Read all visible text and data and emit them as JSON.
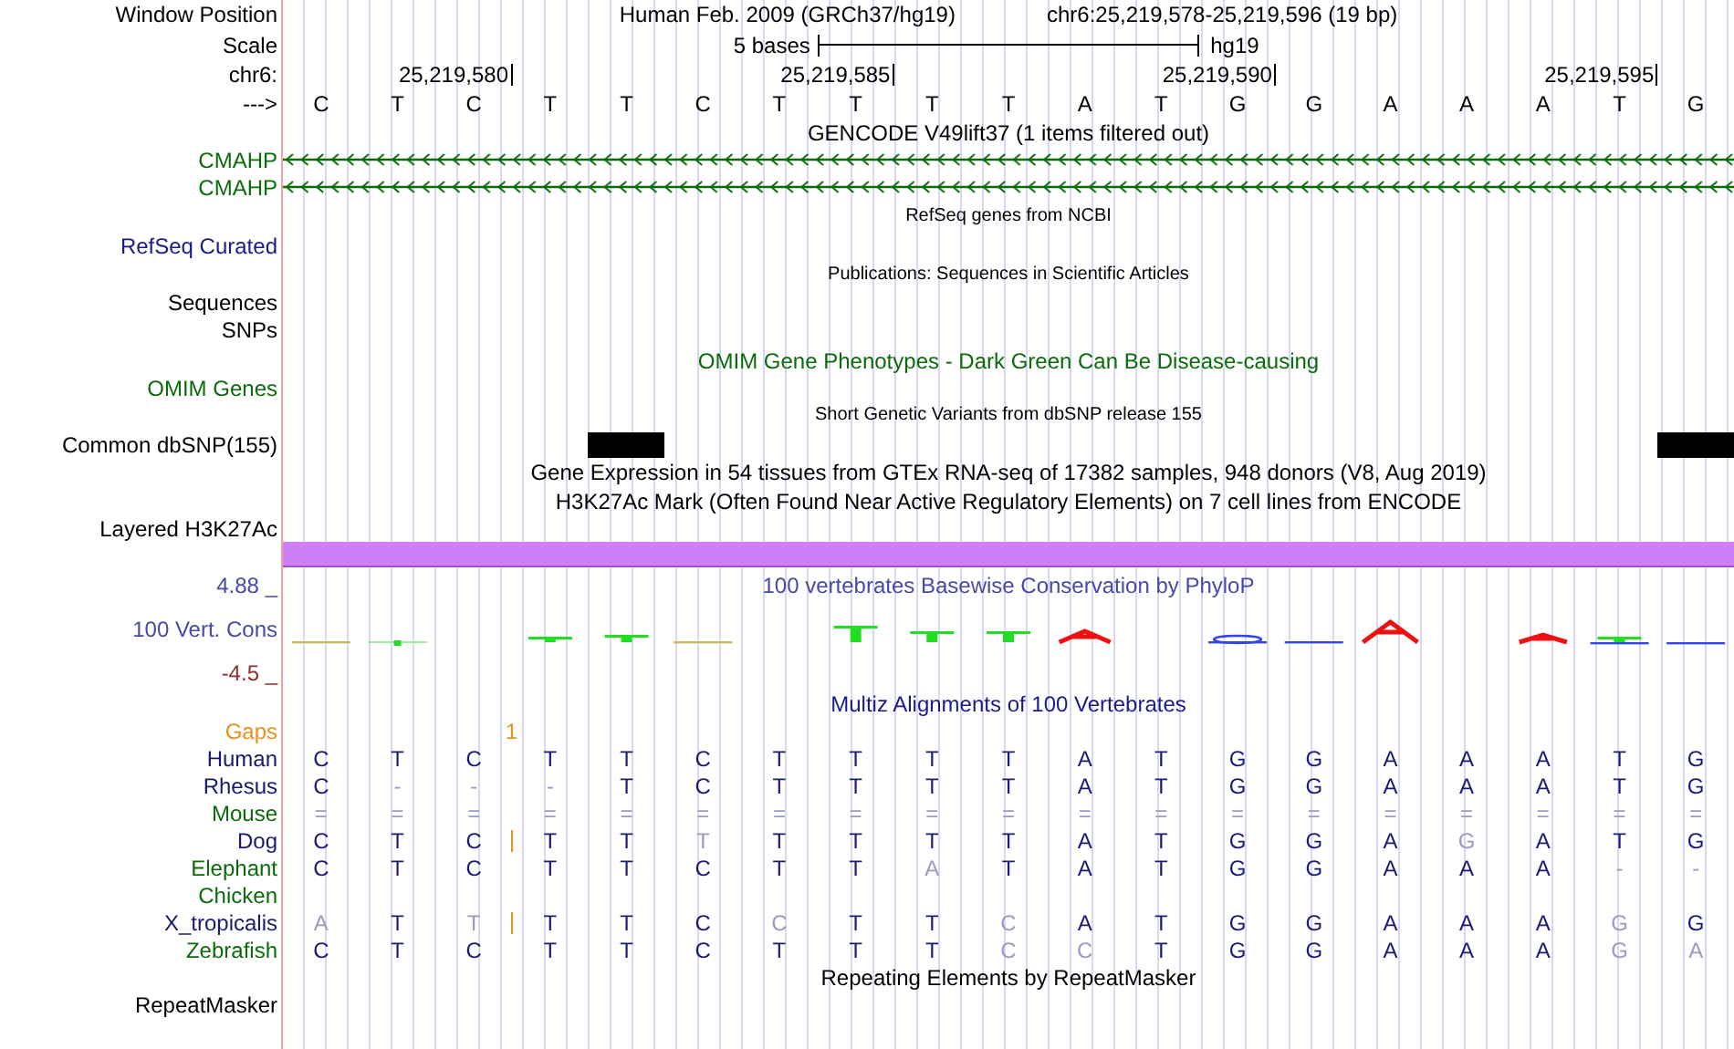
{
  "position": {
    "label": "Window Position",
    "assembly": "Human Feb. 2009 (GRCh37/hg19)",
    "range": "chr6:25,219,578-25,219,596 (19 bp)"
  },
  "scale": {
    "label": "Scale",
    "span": "5 bases",
    "db": "hg19"
  },
  "ruler": {
    "label": "chr6:",
    "ticks": [
      "25,219,580",
      "25,219,585",
      "25,219,590",
      "25,219,595"
    ]
  },
  "sequence": {
    "label": "--->",
    "bases": [
      "C",
      "T",
      "C",
      "T",
      "T",
      "C",
      "T",
      "T",
      "T",
      "T",
      "A",
      "T",
      "G",
      "G",
      "A",
      "A",
      "A",
      "T",
      "G"
    ]
  },
  "gencode": {
    "title": "GENCODE V49lift37 (1 items filtered out)",
    "genes": [
      {
        "name": "CMAHP"
      },
      {
        "name": "CMAHP"
      }
    ]
  },
  "refseq": {
    "title": "RefSeq genes from NCBI",
    "label": "RefSeq Curated"
  },
  "publications": {
    "title": "Publications: Sequences in Scientific Articles",
    "label": "Sequences"
  },
  "snps": {
    "label": "SNPs"
  },
  "omim": {
    "title": "OMIM Gene Phenotypes - Dark Green Can Be Disease-causing",
    "label": "OMIM Genes"
  },
  "dbsnp": {
    "title": "Short Genetic Variants from dbSNP release 155",
    "label": "Common dbSNP(155)",
    "cells": [
      {
        "variant": false
      },
      {
        "variant": false
      },
      {
        "variant": false
      },
      {
        "variant": false
      },
      {
        "variant": true
      },
      {
        "variant": false
      },
      {
        "variant": false
      },
      {
        "variant": false
      },
      {
        "variant": false
      },
      {
        "variant": false
      },
      {
        "variant": false
      },
      {
        "variant": false
      },
      {
        "variant": false
      },
      {
        "variant": false
      },
      {
        "variant": false
      },
      {
        "variant": false
      },
      {
        "variant": false
      },
      {
        "variant": false
      },
      {
        "variant": true
      }
    ]
  },
  "gtex": {
    "title": "Gene Expression in 54 tissues from GTEx RNA-seq of 17382 samples, 948 donors (V8, Aug 2019)"
  },
  "h3k27ac": {
    "title": "H3K27Ac Mark (Often Found Near Active Regulatory Elements) on 7 cell lines from ENCODE",
    "label": "Layered H3K27Ac"
  },
  "phylop": {
    "title": "100 vertebrates Basewise Conservation by PhyloP",
    "label": "100 Vert. Cons",
    "max": "4.88 _",
    "min": "-4.5 _"
  },
  "multiz": {
    "title": "Multiz Alignments of 100 Vertebrates",
    "gaps": {
      "label": "Gaps",
      "count": "1"
    },
    "species": [
      {
        "name": "Human",
        "color": "#191970",
        "insertion": false,
        "bases": [
          {
            "b": "C",
            "dim": false
          },
          {
            "b": "T",
            "dim": false
          },
          {
            "b": "C",
            "dim": false
          },
          {
            "b": "T",
            "dim": false
          },
          {
            "b": "T",
            "dim": false
          },
          {
            "b": "C",
            "dim": false
          },
          {
            "b": "T",
            "dim": false
          },
          {
            "b": "T",
            "dim": false
          },
          {
            "b": "T",
            "dim": false
          },
          {
            "b": "T",
            "dim": false
          },
          {
            "b": "A",
            "dim": false
          },
          {
            "b": "T",
            "dim": false
          },
          {
            "b": "G",
            "dim": false
          },
          {
            "b": "G",
            "dim": false
          },
          {
            "b": "A",
            "dim": false
          },
          {
            "b": "A",
            "dim": false
          },
          {
            "b": "A",
            "dim": false
          },
          {
            "b": "T",
            "dim": false
          },
          {
            "b": "G",
            "dim": false
          }
        ]
      },
      {
        "name": "Rhesus",
        "color": "#191970",
        "insertion": false,
        "bases": [
          {
            "b": "C",
            "dim": false
          },
          {
            "b": "-",
            "dim": true
          },
          {
            "b": "-",
            "dim": true
          },
          {
            "b": "-",
            "dim": true
          },
          {
            "b": "T",
            "dim": false
          },
          {
            "b": "C",
            "dim": false
          },
          {
            "b": "T",
            "dim": false
          },
          {
            "b": "T",
            "dim": false
          },
          {
            "b": "T",
            "dim": false
          },
          {
            "b": "T",
            "dim": false
          },
          {
            "b": "A",
            "dim": false
          },
          {
            "b": "T",
            "dim": false
          },
          {
            "b": "G",
            "dim": false
          },
          {
            "b": "G",
            "dim": false
          },
          {
            "b": "A",
            "dim": false
          },
          {
            "b": "A",
            "dim": false
          },
          {
            "b": "A",
            "dim": false
          },
          {
            "b": "T",
            "dim": false
          },
          {
            "b": "G",
            "dim": false
          }
        ]
      },
      {
        "name": "Mouse",
        "color": "#0b6b0b",
        "insertion": false,
        "bases": [
          {
            "b": "=",
            "dim": true
          },
          {
            "b": "=",
            "dim": true
          },
          {
            "b": "=",
            "dim": true
          },
          {
            "b": "=",
            "dim": true
          },
          {
            "b": "=",
            "dim": true
          },
          {
            "b": "=",
            "dim": true
          },
          {
            "b": "=",
            "dim": true
          },
          {
            "b": "=",
            "dim": true
          },
          {
            "b": "=",
            "dim": true
          },
          {
            "b": "=",
            "dim": true
          },
          {
            "b": "=",
            "dim": true
          },
          {
            "b": "=",
            "dim": true
          },
          {
            "b": "=",
            "dim": true
          },
          {
            "b": "=",
            "dim": true
          },
          {
            "b": "=",
            "dim": true
          },
          {
            "b": "=",
            "dim": true
          },
          {
            "b": "=",
            "dim": true
          },
          {
            "b": "=",
            "dim": true
          },
          {
            "b": "=",
            "dim": true
          }
        ]
      },
      {
        "name": "Dog",
        "color": "#191970",
        "insertion": true,
        "bases": [
          {
            "b": "C",
            "dim": false
          },
          {
            "b": "T",
            "dim": false
          },
          {
            "b": "C",
            "dim": false
          },
          {
            "b": "T",
            "dim": false
          },
          {
            "b": "T",
            "dim": false
          },
          {
            "b": "T",
            "dim": true
          },
          {
            "b": "T",
            "dim": false
          },
          {
            "b": "T",
            "dim": false
          },
          {
            "b": "T",
            "dim": false
          },
          {
            "b": "T",
            "dim": false
          },
          {
            "b": "A",
            "dim": false
          },
          {
            "b": "T",
            "dim": false
          },
          {
            "b": "G",
            "dim": false
          },
          {
            "b": "G",
            "dim": false
          },
          {
            "b": "A",
            "dim": false
          },
          {
            "b": "G",
            "dim": true
          },
          {
            "b": "A",
            "dim": false
          },
          {
            "b": "T",
            "dim": false
          },
          {
            "b": "G",
            "dim": false
          }
        ]
      },
      {
        "name": "Elephant",
        "color": "#0b6b0b",
        "insertion": false,
        "bases": [
          {
            "b": "C",
            "dim": false
          },
          {
            "b": "T",
            "dim": false
          },
          {
            "b": "C",
            "dim": false
          },
          {
            "b": "T",
            "dim": false
          },
          {
            "b": "T",
            "dim": false
          },
          {
            "b": "C",
            "dim": false
          },
          {
            "b": "T",
            "dim": false
          },
          {
            "b": "T",
            "dim": false
          },
          {
            "b": "A",
            "dim": true
          },
          {
            "b": "T",
            "dim": false
          },
          {
            "b": "A",
            "dim": false
          },
          {
            "b": "T",
            "dim": false
          },
          {
            "b": "G",
            "dim": false
          },
          {
            "b": "G",
            "dim": false
          },
          {
            "b": "A",
            "dim": false
          },
          {
            "b": "A",
            "dim": false
          },
          {
            "b": "A",
            "dim": false
          },
          {
            "b": "-",
            "dim": true
          },
          {
            "b": "-",
            "dim": true
          }
        ]
      },
      {
        "name": "Chicken",
        "color": "#0b6b0b",
        "insertion": false
      },
      {
        "name": "X_tropicalis",
        "color": "#191970",
        "insertion": true,
        "bases": [
          {
            "b": "A",
            "dim": true
          },
          {
            "b": "T",
            "dim": false
          },
          {
            "b": "T",
            "dim": true
          },
          {
            "b": "T",
            "dim": false
          },
          {
            "b": "T",
            "dim": false
          },
          {
            "b": "C",
            "dim": false
          },
          {
            "b": "C",
            "dim": true
          },
          {
            "b": "T",
            "dim": false
          },
          {
            "b": "T",
            "dim": false
          },
          {
            "b": "C",
            "dim": true
          },
          {
            "b": "A",
            "dim": false
          },
          {
            "b": "T",
            "dim": false
          },
          {
            "b": "G",
            "dim": false
          },
          {
            "b": "G",
            "dim": false
          },
          {
            "b": "A",
            "dim": false
          },
          {
            "b": "A",
            "dim": false
          },
          {
            "b": "A",
            "dim": false
          },
          {
            "b": "G",
            "dim": true
          },
          {
            "b": "G",
            "dim": false
          }
        ]
      },
      {
        "name": "Zebrafish",
        "color": "#0b6b0b",
        "insertion": false,
        "bases": [
          {
            "b": "C",
            "dim": false
          },
          {
            "b": "T",
            "dim": false
          },
          {
            "b": "C",
            "dim": false
          },
          {
            "b": "T",
            "dim": false
          },
          {
            "b": "T",
            "dim": false
          },
          {
            "b": "C",
            "dim": false
          },
          {
            "b": "T",
            "dim": false
          },
          {
            "b": "T",
            "dim": false
          },
          {
            "b": "T",
            "dim": false
          },
          {
            "b": "C",
            "dim": true
          },
          {
            "b": "C",
            "dim": true
          },
          {
            "b": "T",
            "dim": false
          },
          {
            "b": "G",
            "dim": false
          },
          {
            "b": "G",
            "dim": false
          },
          {
            "b": "A",
            "dim": false
          },
          {
            "b": "A",
            "dim": false
          },
          {
            "b": "A",
            "dim": false
          },
          {
            "b": "G",
            "dim": true
          },
          {
            "b": "A",
            "dim": true
          }
        ]
      }
    ]
  },
  "repeatmasker": {
    "title": "Repeating Elements by RepeatMasker",
    "label": "RepeatMasker"
  }
}
